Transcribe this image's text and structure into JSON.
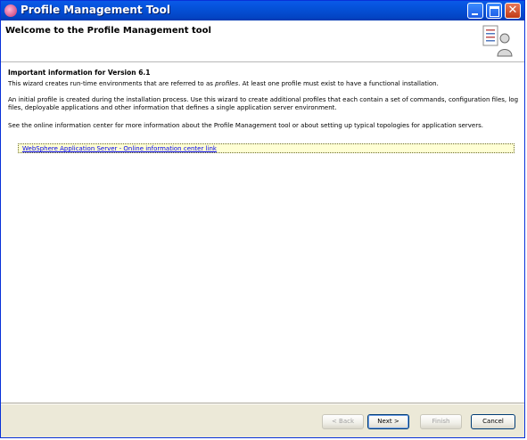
{
  "window": {
    "title": "Profile Management Tool"
  },
  "header": {
    "title": "Welcome to the Profile Management tool"
  },
  "content": {
    "section_title": "Important information for Version 6.1",
    "p1_before": "This wizard creates run-time environments that are referred to as ",
    "p1_italic": "profiles",
    "p1_after": ". At least one profile must exist to have a functional installation.",
    "p2": "An initial profile is created during the installation process. Use this wizard to create additional profiles that each contain a set of commands, configuration files, log files, deployable applications and other information that defines a single application server environment.",
    "p3": "See the online information center for more information about the Profile Management tool or about setting up typical topologies for application servers.",
    "link": "WebSphere Application Server - Online information center link"
  },
  "buttons": {
    "back": "< Back",
    "next": "Next >",
    "finish": "Finish",
    "cancel": "Cancel"
  },
  "icons": {
    "app": "websphere-app-icon",
    "wizard": "profile-wizard-icon",
    "minimize": "minimize-icon",
    "maximize": "maximize-icon",
    "close": "close-icon"
  },
  "colors": {
    "titlebar": "#0451d8",
    "link": "#0000ee",
    "link_box_bg": "#ffffd4"
  }
}
